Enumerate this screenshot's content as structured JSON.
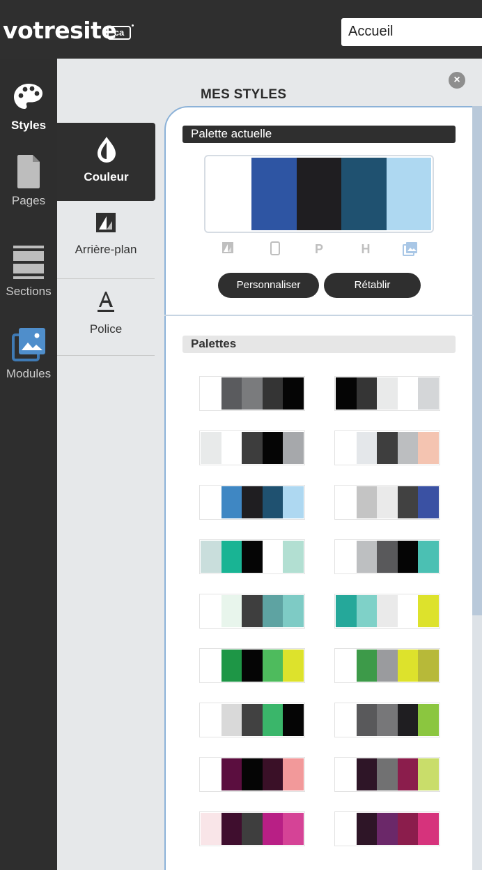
{
  "header": {
    "logo_text": "votresite",
    "logo_badge": "ca",
    "page_select_value": "Accueil"
  },
  "sidebar": {
    "items": [
      {
        "label": "Styles",
        "icon": "palette-icon",
        "active": true
      },
      {
        "label": "Pages",
        "icon": "page-icon",
        "active": false
      },
      {
        "label": "Sections",
        "icon": "sections-icon",
        "active": false
      },
      {
        "label": "Modules",
        "icon": "image-gallery-icon",
        "active": false
      }
    ]
  },
  "subpanel": {
    "items": [
      {
        "label": "Couleur",
        "icon": "drop-icon",
        "active": true
      },
      {
        "label": "Arrière-plan",
        "icon": "background-icon",
        "active": false
      },
      {
        "label": "Police",
        "icon": "font-a-icon",
        "active": false
      }
    ]
  },
  "panel": {
    "title": "MES STYLES",
    "current_palette_label": "Palette actuelle",
    "current_palette": [
      "#ffffff",
      "#2e55a3",
      "#1f1e21",
      "#1f5170",
      "#aed8f1"
    ],
    "palette_role_icons": [
      {
        "name": "background-icon",
        "glyph": ""
      },
      {
        "name": "mobile-icon",
        "glyph": ""
      },
      {
        "name": "paragraph-icon",
        "glyph": "P"
      },
      {
        "name": "heading-icon",
        "glyph": "H"
      },
      {
        "name": "image-icon",
        "glyph": ""
      }
    ],
    "customize_label": "Personnaliser",
    "reset_label": "Rétablir",
    "palettes_label": "Palettes",
    "palettes": [
      [
        "#ffffff",
        "#5a5b5e",
        "#7a7b7d",
        "#343434",
        "#050505"
      ],
      [
        "#050505",
        "#353535",
        "#e9eaea",
        "#ffffff",
        "#d4d6d8"
      ],
      [
        "#e8eaea",
        "#ffffff",
        "#3d3d3d",
        "#050505",
        "#a6a8ab"
      ],
      [
        "#ffffff",
        "#e4e7ea",
        "#3e3e3e",
        "#bcbec0",
        "#f4c4b1"
      ],
      [
        "#ffffff",
        "#3f87c3",
        "#1f1e21",
        "#1f5170",
        "#aed8f1"
      ],
      [
        "#ffffff",
        "#c4c4c4",
        "#eaeaea",
        "#414141",
        "#3a51a3"
      ],
      [
        "#c9dedc",
        "#19b494",
        "#050505",
        "#ffffff",
        "#b2dfd2"
      ],
      [
        "#ffffff",
        "#bdbfc1",
        "#59595b",
        "#050505",
        "#4bc0b3"
      ],
      [
        "#ffffff",
        "#e8f5ec",
        "#3e3e3e",
        "#5ea3a2",
        "#7ecbc5"
      ],
      [
        "#25a89a",
        "#7fd1c8",
        "#eaeaea",
        "#ffffff",
        "#dde22c"
      ],
      [
        "#ffffff",
        "#1e9646",
        "#050505",
        "#4ebb5d",
        "#dde22c"
      ],
      [
        "#ffffff",
        "#3d9a49",
        "#9a9b9e",
        "#dde22c",
        "#b7b939"
      ],
      [
        "#ffffff",
        "#d9d9d9",
        "#414141",
        "#3ab66a",
        "#050505"
      ],
      [
        "#ffffff",
        "#59595b",
        "#777779",
        "#1f1e21",
        "#8bc63f"
      ],
      [
        "#ffffff",
        "#5b0e3f",
        "#050505",
        "#3a1027",
        "#f2999a"
      ],
      [
        "#ffffff",
        "#2e1527",
        "#717172",
        "#8b1d4c",
        "#c9dd6a"
      ],
      [
        "#f9e5e8",
        "#3f0e2e",
        "#3e3e3e",
        "#b81f85",
        "#d54396"
      ],
      [
        "#ffffff",
        "#2e1527",
        "#6b2869",
        "#8b1d4c",
        "#d6337c"
      ]
    ]
  }
}
